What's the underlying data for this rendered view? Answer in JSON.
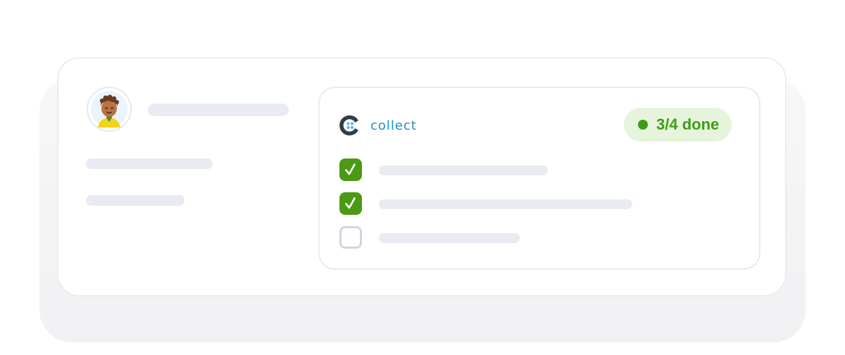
{
  "brand": {
    "name": "collect",
    "logo_icon": "collect-logo-icon",
    "color": "#1d8fc6"
  },
  "progress": {
    "label": "3/4 done",
    "completed": 3,
    "total": 4,
    "color": "#3f9c18",
    "background": "#e6f4dc"
  },
  "user": {
    "avatar_icon": "user-avatar-icon"
  },
  "checklist": [
    {
      "checked": true,
      "icon": "checkmark-icon"
    },
    {
      "checked": true,
      "icon": "checkmark-icon"
    },
    {
      "checked": false,
      "icon": "empty-checkbox-icon"
    }
  ],
  "colors": {
    "skeleton": "#e8ebf1",
    "check_on": "#4a9a16",
    "check_off_border": "#d1d5e0"
  }
}
